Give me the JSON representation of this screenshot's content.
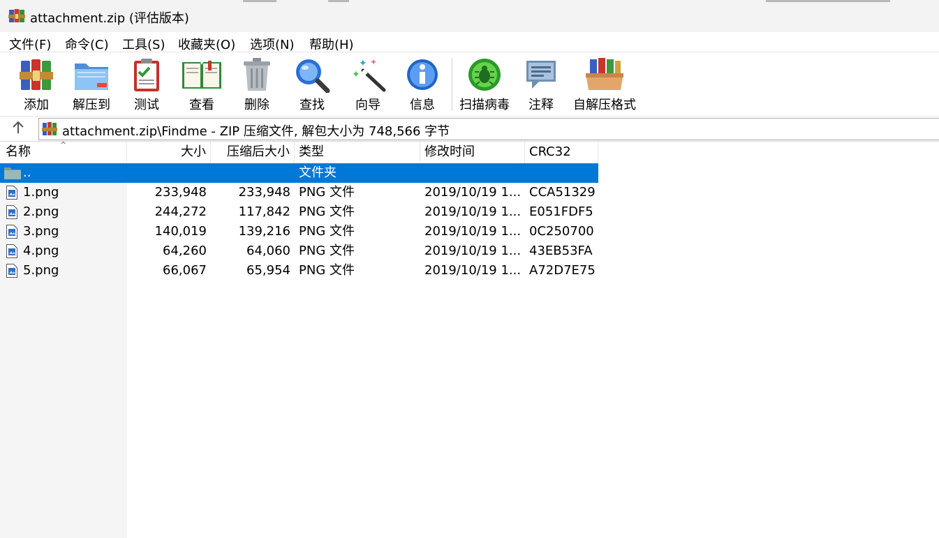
{
  "window": {
    "title": "attachment.zip (评估版本)",
    "icon": "winrar-books-icon"
  },
  "menu": [
    "文件(F)",
    "命令(C)",
    "工具(S)",
    "收藏夹(O)",
    "选项(N)",
    "帮助(H)"
  ],
  "toolbar": {
    "add": "添加",
    "extract_to": "解压到",
    "test": "测试",
    "view": "查看",
    "delete": "删除",
    "find": "查找",
    "wizard": "向导",
    "info": "信息",
    "virus_scan": "扫描病毒",
    "comment": "注释",
    "sfx": "自解压格式"
  },
  "address": {
    "path": "attachment.zip\\Findme - ZIP 压缩文件, 解包大小为 748,566 字节"
  },
  "columns": {
    "name": "名称",
    "size": "大小",
    "packed": "压缩后大小",
    "type": "类型",
    "modified": "修改时间",
    "crc": "CRC32"
  },
  "parent_row": {
    "name": "..",
    "type": "文件夹"
  },
  "files": [
    {
      "name": "1.png",
      "size": "233,948",
      "packed": "233,948",
      "type": "PNG 文件",
      "modified": "2019/10/19 1...",
      "crc": "CCA51329"
    },
    {
      "name": "2.png",
      "size": "244,272",
      "packed": "117,842",
      "type": "PNG 文件",
      "modified": "2019/10/19 1...",
      "crc": "E051FDF5"
    },
    {
      "name": "3.png",
      "size": "140,019",
      "packed": "139,216",
      "type": "PNG 文件",
      "modified": "2019/10/19 1...",
      "crc": "0C250700"
    },
    {
      "name": "4.png",
      "size": "64,260",
      "packed": "64,060",
      "type": "PNG 文件",
      "modified": "2019/10/19 1...",
      "crc": "43EB53FA"
    },
    {
      "name": "5.png",
      "size": "66,067",
      "packed": "65,954",
      "type": "PNG 文件",
      "modified": "2019/10/19 1...",
      "crc": "A72D7E75"
    }
  ],
  "colors": {
    "selection": "#0078d7",
    "name_column_bg": "#f5f5f5"
  }
}
